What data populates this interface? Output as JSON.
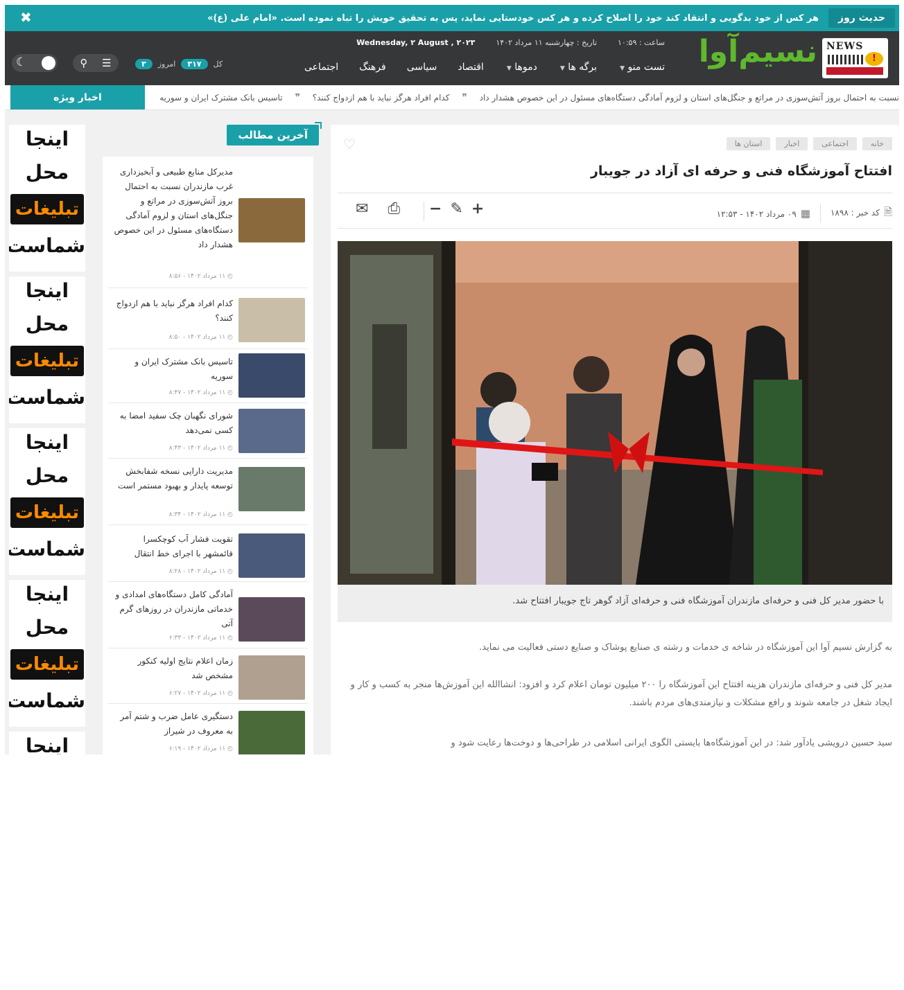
{
  "hadith": {
    "tag": "حدیث روز",
    "text": "هر کس از خود بدگویی و انتقاد کند خود را اصلاح کرده و هر کس خودستایی نماید، پس به تحقیق خویش را تباه نموده است. «امام علی (ع)»",
    "close": "✖"
  },
  "header": {
    "logo_text": "NEWS",
    "brand": "نسیم‌آوا",
    "meta": {
      "time": "ساعت : ۱۰:۵۹",
      "date_fa": "تاریخ : چهارشنبه ۱۱ مرداد ۱۴۰۲",
      "date_en": "Wednesday, ۲ August , ۲۰۲۳"
    },
    "nav": [
      {
        "label": "تست منو",
        "has_menu": true
      },
      {
        "label": "برگه ها",
        "has_menu": true
      },
      {
        "label": "دموها",
        "has_menu": true
      },
      {
        "label": "اقتصاد",
        "has_menu": false
      },
      {
        "label": "سیاسی",
        "has_menu": false
      },
      {
        "label": "فرهنگ",
        "has_menu": false
      },
      {
        "label": "اجتماعی",
        "has_menu": false
      }
    ],
    "counters": {
      "total_label": "کل",
      "total_value": "۳۱۷",
      "today_label": "امروز",
      "today_value": "۳"
    },
    "icons": {
      "menu": "☰",
      "search": "⚲",
      "moon": "☾"
    }
  },
  "ticker": {
    "label": "اخبار ویژه",
    "items": [
      "نسبت به احتمال بروز آتش‌سوزی در مراتع و جنگل‌های استان و لزوم آمادگی دستگاه‌های مسئول در این خصوص هشدار داد",
      "کدام افراد هرگز نباید با هم ازدواج کنند؟",
      "تاسیس بانک مشترک ایران و سوریه"
    ],
    "sep": "❞"
  },
  "article": {
    "breadcrumbs": [
      "خانه",
      "اجتماعی",
      "اخبار",
      "استان ها"
    ],
    "heart": "♡",
    "title": "افتتاح آموزشگاه فنی و حرفه ای آزاد در جویبار",
    "code_label": "کد خبر : ۱۸۹۸",
    "date_label": "۰۹ مرداد ۱۴۰۲ - ۱۲:۵۳",
    "tools": {
      "plus": "+",
      "edit": "✎",
      "minus": "−",
      "print": "⎙",
      "mail": "✉"
    },
    "caption": "با حضور مدیر کل فنی و حرفه‌ای مازندران آموزشگاه فنی و حرفه‌ای آزاد گوهر تاج جویبار افتتاح شد.",
    "paragraphs": [
      "به گزارش نسیم آوا این آموزشگاه در شاخه ی خدمات و رشته ی صنایع پوشاک و صنایع دستی فعالیت می نماید.",
      "مدیر کل فنی و حرفه‌ای مازندران هزینه افتتاح این آموزشگاه را ۲۰۰ میلیون تومان اعلام کرد و افزود: انشاالله این آموزش‌ها منجر به کسب و کار و ایجاد شغل در جامعه شوند و رافع مشکلات و نیازمندی‌های مردم باشند.",
      "سید حسین درویشی یادآور شد: در این آموزشگاه‌ها بایستی الگوی ایرانی اسلامی در طراحی‌ها و دوخت‌ها رعایت شود و"
    ]
  },
  "latest": {
    "title": "آخرین مطالب",
    "items": [
      {
        "title": "مدیرکل منابع طبیعی و آبخیزداری غرب مازندران نسبت به احتمال بروز آتش‌سوزی در مراتع و جنگل‌های استان و لزوم آمادگی دستگاه‌های مسئول در این خصوص هشدار داد",
        "time": "۱۱ مرداد ۱۴۰۲ - ۸:۵۶",
        "color": "#8a6a3c"
      },
      {
        "title": "کدام افراد هرگز نباید با هم ازدواج کنند؟",
        "time": "۱۱ مرداد ۱۴۰۲ - ۸:۵۰",
        "color": "#c9bfa8"
      },
      {
        "title": "تاسیس بانک مشترک ایران و سوریه",
        "time": "۱۱ مرداد ۱۴۰۲ - ۸:۴۷",
        "color": "#3a4a6a"
      },
      {
        "title": "شورای نگهبان چک سفید امضا به کسی نمی‌دهد",
        "time": "۱۱ مرداد ۱۴۰۲ - ۸:۴۳",
        "color": "#5a6a8a"
      },
      {
        "title": "مدیریت دارایی نسخه شفابخش توسعه پایدار و بهبود مستمر است",
        "time": "۱۱ مرداد ۱۴۰۲ - ۸:۳۴",
        "color": "#6a7a6a"
      },
      {
        "title": "تقویت فشار آب کوچکسرا قائمشهر با اجرای خط انتقال",
        "time": "۱۱ مرداد ۱۴۰۲ - ۸:۲۸",
        "color": "#4a5a7a"
      },
      {
        "title": "آمادگی کامل دستگاه‌های امدادی و خدماتی مازندران در روزهای گرم آتی",
        "time": "۱۱ مرداد ۱۴۰۲ - ۶:۳۳",
        "color": "#5a4a5a"
      },
      {
        "title": "زمان اعلام نتایج اولیه کنکور مشخص شد",
        "time": "۱۱ مرداد ۱۴۰۲ - ۶:۲۷",
        "color": "#b0a090"
      },
      {
        "title": "دستگیری عامل ضرب و شتم آمر به معروف در شیراز",
        "time": "۱۱ مرداد ۱۴۰۲ - ۶:۱۹",
        "color": "#4a6a3a"
      }
    ]
  },
  "ads": {
    "line1": "اینجا",
    "line2": "محل",
    "line3": "تبلیغات",
    "line4": "شماست"
  },
  "colors": {
    "accent": "#1aa0a8",
    "header_bg": "#353738",
    "brand_green": "#5fb82e",
    "ad_orange": "#ff8a00"
  }
}
